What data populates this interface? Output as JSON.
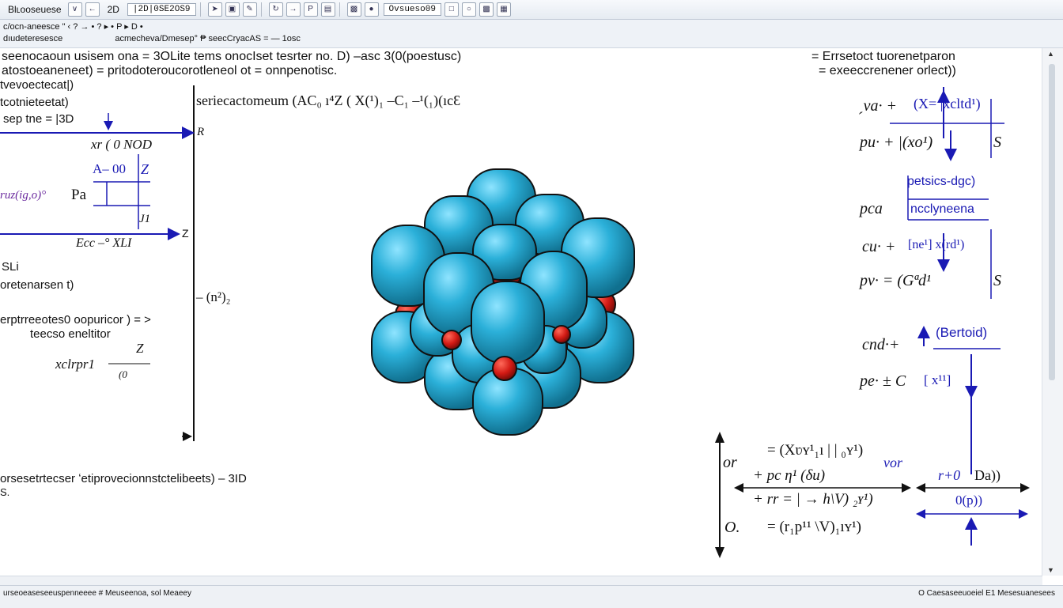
{
  "toolbar": {
    "app_title": "Blʟooseuese",
    "mode_label": "2D",
    "field_label": "|2D|0SE2OS9",
    "search_value": "Ovsueso09",
    "icons": [
      "v-icon",
      "arrow-left-icon",
      "arrow-right-icon",
      "pointer-icon",
      "save-icon",
      "edit-icon",
      "rotate-icon",
      "letter-p-icon",
      "folder-icon",
      "image-icon",
      "globe-icon",
      "circle-icon",
      "print-icon",
      "window-icon"
    ]
  },
  "subbar": {
    "row1": "c/ocn-aneesce \"  ‹  ?  →  •  ?  ▸  •  P  ▸  D  •",
    "row2_left": "dıudeteresesce",
    "row2_mid": "acmecheva/Dmesep°  ₱ seecCryacAS = — 1osc"
  },
  "canvas": {
    "header_line1": "seenocaoun usisem   ona = 3OLite tems onocIset tesrter no.  D) –asc 3(0(poestusc)",
    "header_line2": "atostoeaneneet)            =  pritodoteroucorotleneol  ot  =  onnpenotisc.",
    "header_right1": "=  Errsetoct tuorenetparon",
    "header_right2": "=  exeeccrenener orlect))",
    "left_labels": {
      "l1": "tvevoectecat|)",
      "l2": "tcotnieteetat)",
      "l3": "sep tne = |3D",
      "l4": "xr ( 0  NOD",
      "l5": "A– 00",
      "l5b": "Z",
      "l6": "ruz(ig,o)°",
      "l6b": "Pa",
      "l7": "J1",
      "l8": "Ecc –° XLI",
      "l9": "SLi",
      "l10": "oretenarsen t)",
      "l11": "erptrreeotes0 oopuricor ) = >",
      "l12": "teecso eneltitor",
      "l13": "xclrpr1",
      "l13b": "Z",
      "l13c": "(0",
      "l14": "– (n²)₂",
      "bottom1": "orsesetrtecser ʻetiprovecionnstctelibeets) – 3ID",
      "bottom2": "S."
    },
    "axis_labels": {
      "r": "R",
      "z": "Z",
      "gt": ">"
    },
    "formula_top": "seriecactomeum (AC₀  ı⁴Z  ( X(¹)₁ –C₁ –¹(₁)(ıcƐ",
    "right_panel": {
      "r1": "ˏva· +",
      "r1b": "(X= |xcltd¹)",
      "r2": "pu· + |(xo¹)",
      "r2b": "S",
      "r3_box1": "petsics-dgc)",
      "r3_box2": "ncclyneena",
      "r3": "pca",
      "r4": "cu· +",
      "r4b": "[ne¹]     x(rd¹)",
      "r5": "pv· = (Gªd¹",
      "r5b": "S",
      "r6": "cnd·+",
      "r6b": "(Bertoid)",
      "r7": "pe· ± C",
      "r7b": "[ x¹¹]"
    },
    "bottom_panel": {
      "or": "or",
      "o": "O.",
      "f1": "= (Xʋʏ¹₁ı | | ₀ʏ¹)",
      "f1b": "vor",
      "f2": "+ pc η¹     (δu)",
      "f3": "+ rr  = | → h\\V)  ₂ʏ¹)",
      "f4": "= (r₁p¹¹ \\V)₁ıʏ¹)",
      "g1": "r+0",
      "g1b": "Da))",
      "g2": "0(p))"
    }
  },
  "status": {
    "left": "urseoeaseseeuspenneeee # Meuseenoa, sol Meaeey",
    "right": "O Caesaseeuoeiel E1 Mesesuanesees"
  },
  "colors": {
    "sphere_blue": "#2bb0d9",
    "sphere_red": "#d21a14",
    "annotation_blue": "#1a1ab4"
  }
}
